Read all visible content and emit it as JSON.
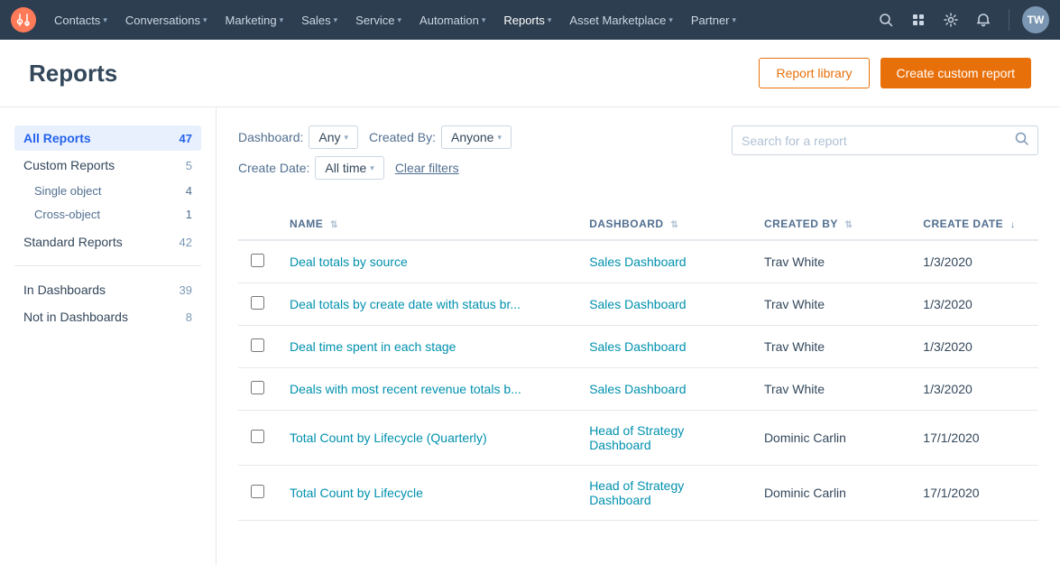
{
  "app": {
    "title": "Reports"
  },
  "nav": {
    "items": [
      {
        "label": "Contacts",
        "id": "contacts"
      },
      {
        "label": "Conversations",
        "id": "conversations"
      },
      {
        "label": "Marketing",
        "id": "marketing"
      },
      {
        "label": "Sales",
        "id": "sales"
      },
      {
        "label": "Service",
        "id": "service"
      },
      {
        "label": "Automation",
        "id": "automation"
      },
      {
        "label": "Reports",
        "id": "reports",
        "active": true
      },
      {
        "label": "Asset Marketplace",
        "id": "asset-marketplace"
      },
      {
        "label": "Partner",
        "id": "partner"
      }
    ]
  },
  "header": {
    "title": "Reports",
    "report_library_label": "Report library",
    "create_custom_report_label": "Create custom report"
  },
  "sidebar": {
    "all_reports_label": "All Reports",
    "all_reports_count": "47",
    "custom_reports_label": "Custom Reports",
    "custom_reports_count": "5",
    "single_object_label": "Single object",
    "single_object_count": "4",
    "cross_object_label": "Cross-object",
    "cross_object_count": "1",
    "standard_reports_label": "Standard Reports",
    "standard_reports_count": "42",
    "in_dashboards_label": "In Dashboards",
    "in_dashboards_count": "39",
    "not_in_dashboards_label": "Not in Dashboards",
    "not_in_dashboards_count": "8"
  },
  "filters": {
    "dashboard_label": "Dashboard:",
    "dashboard_value": "Any",
    "created_by_label": "Created By:",
    "created_by_value": "Anyone",
    "create_date_label": "Create Date:",
    "create_date_value": "All time",
    "clear_filters_label": "Clear filters",
    "search_placeholder": "Search for a report"
  },
  "table": {
    "col_name": "NAME",
    "col_dashboard": "DASHBOARD",
    "col_created_by": "CREATED BY",
    "col_create_date": "CREATE DATE",
    "rows": [
      {
        "name": "Deal totals by source",
        "dashboard": "Sales Dashboard",
        "created_by": "Trav White",
        "create_date": "1/3/2020"
      },
      {
        "name": "Deal totals by create date with status br...",
        "dashboard": "Sales Dashboard",
        "created_by": "Trav White",
        "create_date": "1/3/2020"
      },
      {
        "name": "Deal time spent in each stage",
        "dashboard": "Sales Dashboard",
        "created_by": "Trav White",
        "create_date": "1/3/2020"
      },
      {
        "name": "Deals with most recent revenue totals b...",
        "dashboard": "Sales Dashboard",
        "created_by": "Trav White",
        "create_date": "1/3/2020"
      },
      {
        "name": "Total Count by Lifecycle (Quarterly)",
        "dashboard": "Head of Strategy Dashboard",
        "created_by": "Dominic Carlin",
        "create_date": "17/1/2020"
      },
      {
        "name": "Total Count by Lifecycle",
        "dashboard": "Head of Strategy Dashboard",
        "created_by": "Dominic Carlin",
        "create_date": "17/1/2020"
      }
    ]
  }
}
